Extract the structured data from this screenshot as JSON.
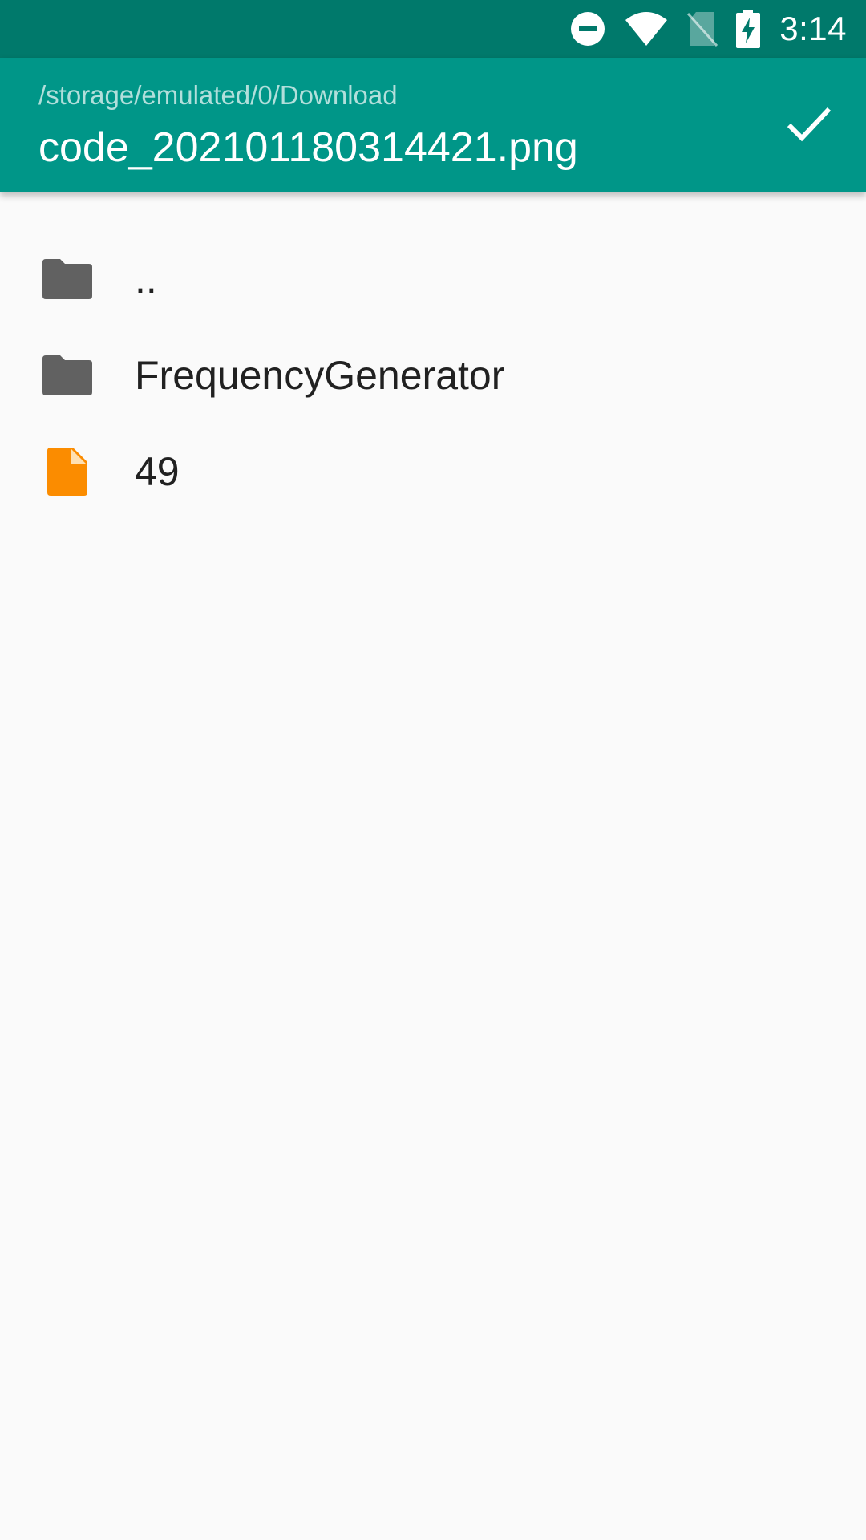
{
  "status_bar": {
    "time": "3:14",
    "icons": [
      "do-not-disturb-icon",
      "wifi-icon",
      "no-sim-icon",
      "battery-charging-icon"
    ]
  },
  "app_bar": {
    "path": "/storage/emulated/0/Download",
    "filename": "code_202101180314421.png",
    "action_icon": "check-icon"
  },
  "file_list": {
    "items": [
      {
        "label": "..",
        "icon": "folder-icon"
      },
      {
        "label": "FrequencyGenerator",
        "icon": "folder-icon"
      },
      {
        "label": "49",
        "icon": "file-icon"
      }
    ]
  },
  "colors": {
    "status_bar": "#00796b",
    "app_bar": "#009688",
    "folder_icon": "#616161",
    "file_icon": "#fb8c00",
    "background": "#fafafa"
  }
}
